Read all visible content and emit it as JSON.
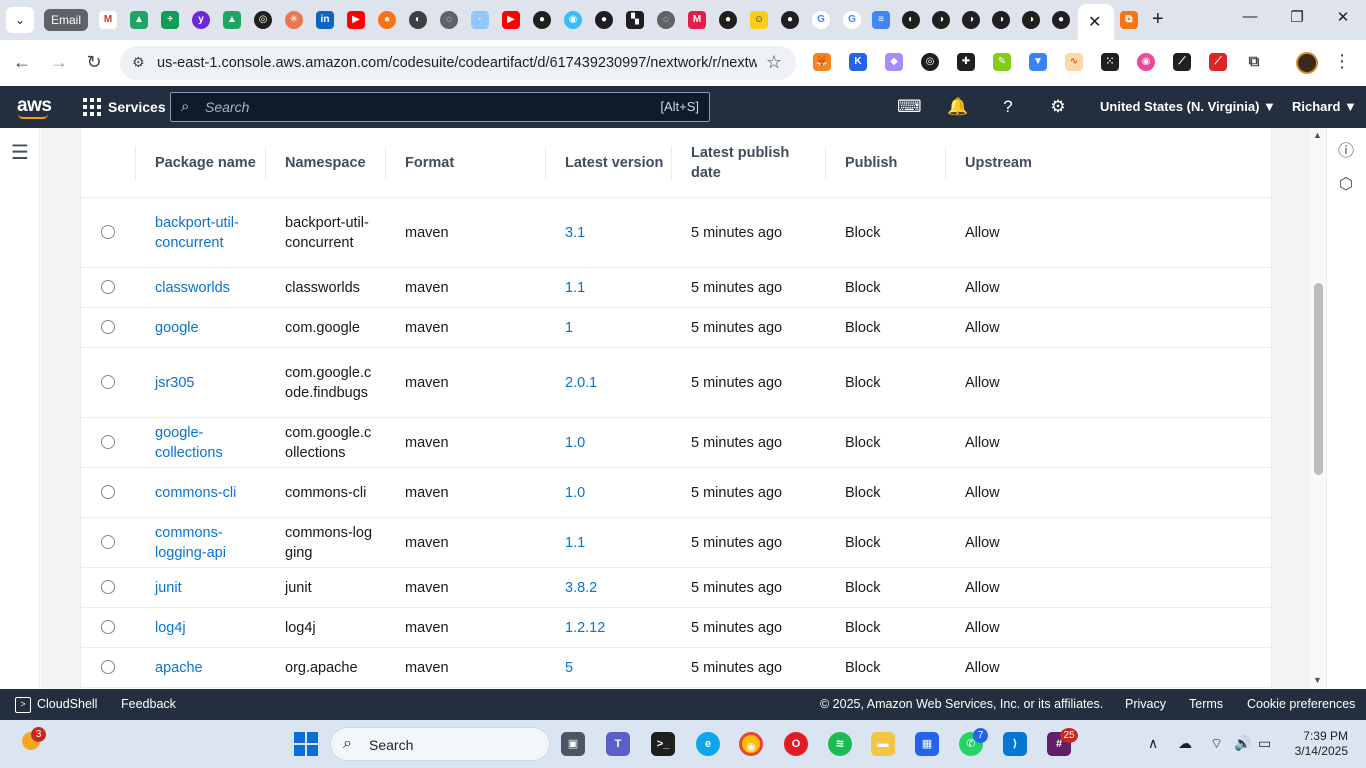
{
  "browser": {
    "tab_email_label": "Email",
    "url": "us-east-1.console.aws.amazon.com/codesuite/codeartifact/d/617439230997/nextwork/r/nextw...",
    "colors": {
      "tabstrip": "#dfe3eb",
      "omnibox": "#eef1f6"
    }
  },
  "aws_nav": {
    "logo": "aws",
    "services_label": "Services",
    "search_placeholder": "Search",
    "search_shortcut": "[Alt+S]",
    "region": "United States (N. Virginia) ▼",
    "user": "Richard ▼",
    "colors": {
      "nav_bg": "#232f3e",
      "accent": "#ff9900"
    }
  },
  "table": {
    "headers": {
      "package_name": "Package name",
      "namespace": "Namespace",
      "format": "Format",
      "latest_version": "Latest version",
      "latest_publish_date": "Latest publish date",
      "publish": "Publish",
      "upstream": "Upstream"
    },
    "rows": [
      {
        "package": "backport-util-concurrent",
        "namespace": "backport-util-concurrent",
        "format": "maven",
        "version": "3.1",
        "date": "5 minutes ago",
        "publish": "Block",
        "upstream": "Allow"
      },
      {
        "package": "classworlds",
        "namespace": "classworlds",
        "format": "maven",
        "version": "1.1",
        "date": "5 minutes ago",
        "publish": "Block",
        "upstream": "Allow"
      },
      {
        "package": "google",
        "namespace": "com.google",
        "format": "maven",
        "version": "1",
        "date": "5 minutes ago",
        "publish": "Block",
        "upstream": "Allow"
      },
      {
        "package": "jsr305",
        "namespace": "com.google.code.findbugs",
        "format": "maven",
        "version": "2.0.1",
        "date": "5 minutes ago",
        "publish": "Block",
        "upstream": "Allow"
      },
      {
        "package": "google-collections",
        "namespace": "com.google.collections",
        "format": "maven",
        "version": "1.0",
        "date": "5 minutes ago",
        "publish": "Block",
        "upstream": "Allow"
      },
      {
        "package": "commons-cli",
        "namespace": "commons-cli",
        "format": "maven",
        "version": "1.0",
        "date": "5 minutes ago",
        "publish": "Block",
        "upstream": "Allow"
      },
      {
        "package": "commons-logging-api",
        "namespace": "commons-logging",
        "format": "maven",
        "version": "1.1",
        "date": "5 minutes ago",
        "publish": "Block",
        "upstream": "Allow"
      },
      {
        "package": "junit",
        "namespace": "junit",
        "format": "maven",
        "version": "3.8.2",
        "date": "5 minutes ago",
        "publish": "Block",
        "upstream": "Allow"
      },
      {
        "package": "log4j",
        "namespace": "log4j",
        "format": "maven",
        "version": "1.2.12",
        "date": "5 minutes ago",
        "publish": "Block",
        "upstream": "Allow"
      },
      {
        "package": "apache",
        "namespace": "org.apache",
        "format": "maven",
        "version": "5",
        "date": "5 minutes ago",
        "publish": "Block",
        "upstream": "Allow"
      }
    ]
  },
  "console_footer": {
    "cloudshell": "CloudShell",
    "feedback": "Feedback",
    "copyright": "© 2025, Amazon Web Services, Inc. or its affiliates.",
    "privacy": "Privacy",
    "terms": "Terms",
    "cookie": "Cookie preferences"
  },
  "taskbar": {
    "weather_badge": "3",
    "search_label": "Search",
    "whatsapp_badge": "7",
    "slack_badge": "25",
    "time": "7:39 PM",
    "date": "3/14/2025"
  }
}
